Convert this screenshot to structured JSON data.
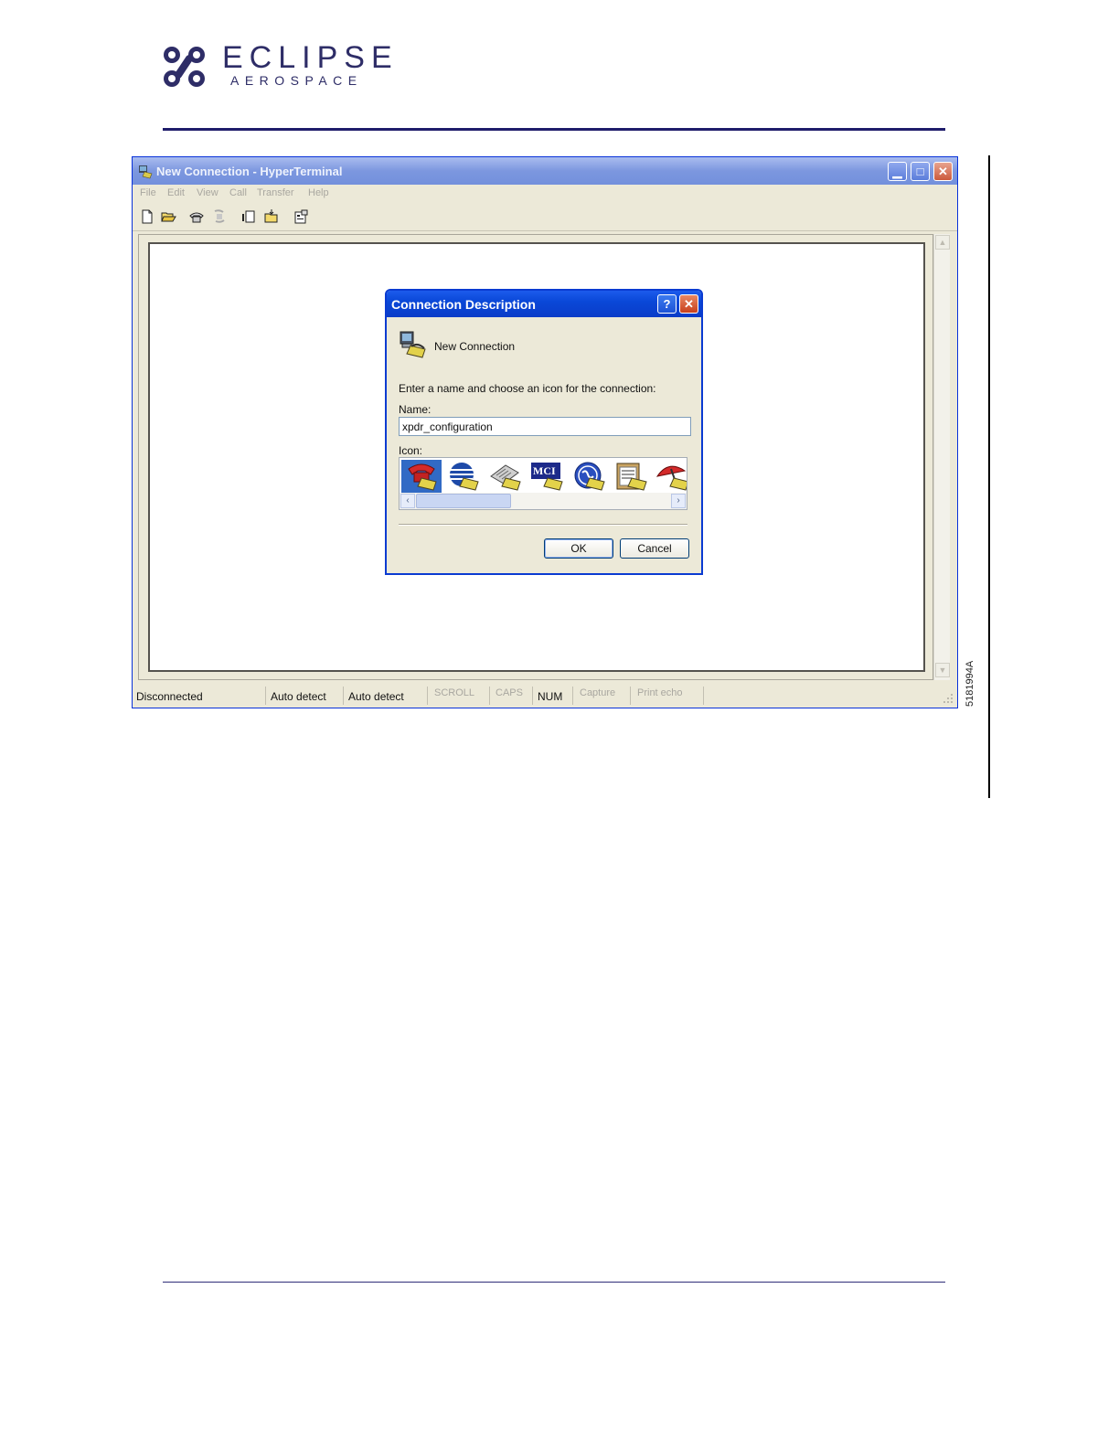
{
  "brand": {
    "title": "ECLIPSE",
    "subtitle": "AEROSPACE",
    "color": "#2e2d67"
  },
  "figure_id": "5181994A",
  "window": {
    "title": "New Connection - HyperTerminal",
    "controls": [
      "minimize-icon",
      "maximize-icon",
      "close-icon"
    ],
    "menu": [
      "File",
      "Edit",
      "View",
      "Call",
      "Transfer",
      "Help"
    ],
    "toolbar_icons": [
      "new-document-icon",
      "open-folder-icon",
      "dial-phone-icon",
      "disconnect-icon",
      "send-file-icon",
      "receive-file-icon",
      "properties-icon"
    ],
    "status": {
      "connection": "Disconnected",
      "emulation": "Auto detect",
      "port_settings": "Auto detect",
      "scroll": "SCROLL",
      "caps": "CAPS",
      "num": "NUM",
      "capture": "Capture",
      "print_echo": "Print echo"
    }
  },
  "dialog": {
    "title": "Connection Description",
    "help_glyph": "?",
    "connection_label": "New Connection",
    "prompt": "Enter a name and choose an icon for the connection:",
    "name_label": "Name:",
    "name_value": "xpdr_configuration",
    "icon_label": "Icon:",
    "icons": [
      "red-phone-icon",
      "globe-phone-icon",
      "fax-phone-icon",
      "mci-phone-icon",
      "ge-phone-icon",
      "clipboard-phone-icon",
      "umbrella-phone-icon"
    ],
    "mci_text": "MCI",
    "ok_label": "OK",
    "cancel_label": "Cancel"
  },
  "colors": {
    "xp_blue": "#0a48d8",
    "selection": "#316ac5",
    "face": "#ece9d8"
  }
}
